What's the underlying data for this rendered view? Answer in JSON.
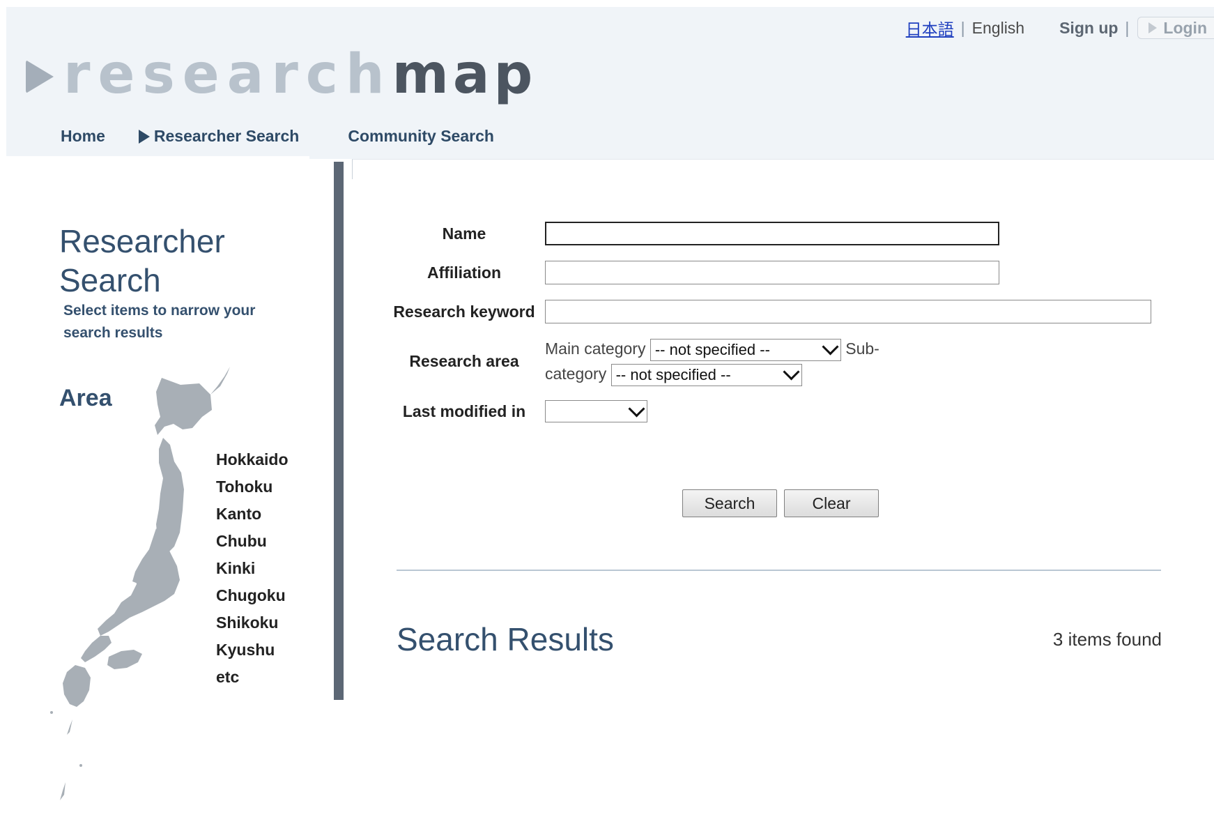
{
  "topbar": {
    "lang_ja": "日本語",
    "separator": "|",
    "lang_en": "English",
    "signup": "Sign up",
    "login": "Login"
  },
  "logo": {
    "light": "research",
    "dark": "map"
  },
  "nav": {
    "home": "Home",
    "researcher_search": "Researcher Search",
    "community_search": "Community Search"
  },
  "sidebar": {
    "title_line1": "Researcher",
    "title_line2": "Search",
    "subtitle": "Select items to narrow your search results",
    "area_title": "Area",
    "regions": [
      "Hokkaido",
      "Tohoku",
      "Kanto",
      "Chubu",
      "Kinki",
      "Chugoku",
      "Shikoku",
      "Kyushu",
      "etc"
    ]
  },
  "form": {
    "name_label": "Name",
    "name_value": "",
    "affiliation_label": "Affiliation",
    "affiliation_value": "",
    "keyword_label": "Research keyword",
    "keyword_value": "",
    "area_label": "Research area",
    "main_category_label": "Main category",
    "main_category_value": "-- not specified --",
    "sub_category_label_1": "Sub-",
    "sub_category_label_2": "category",
    "sub_category_value": "-- not specified --",
    "modified_label": "Last modified in",
    "modified_value": ""
  },
  "buttons": {
    "search": "Search",
    "clear": "Clear"
  },
  "results": {
    "title": "Search Results",
    "count": "3 items found"
  },
  "colors": {
    "header_bg": "#f0f4f8",
    "accent": "#34506e",
    "sidebar_border": "#5c6775",
    "map": "#a8afb6"
  }
}
